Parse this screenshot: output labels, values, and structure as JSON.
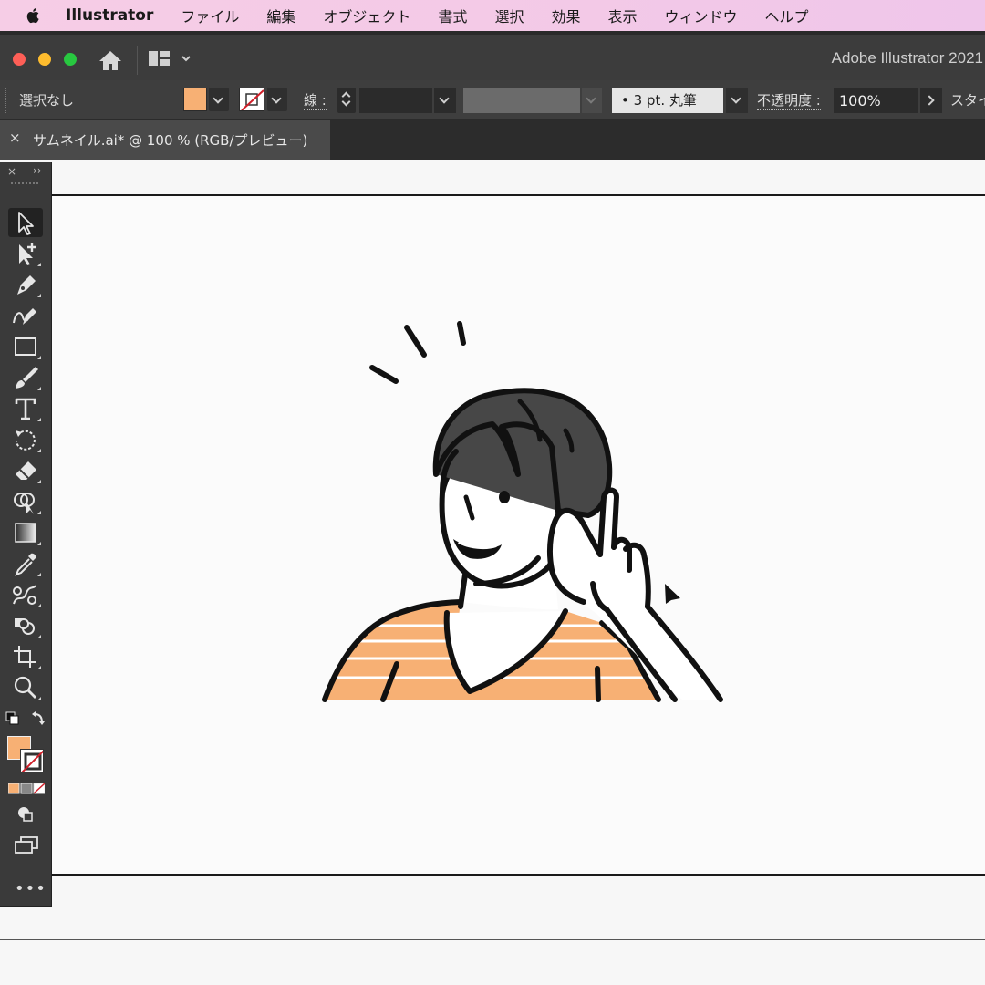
{
  "menubar": {
    "apple": "apple-logo",
    "app_name": "Illustrator",
    "items": [
      "ファイル",
      "編集",
      "オブジェクト",
      "書式",
      "選択",
      "効果",
      "表示",
      "ウィンドウ",
      "ヘルプ"
    ]
  },
  "window": {
    "title": "Adobe Illustrator 2021"
  },
  "control_bar": {
    "selection_status": "選択なし",
    "fill_color": "#f7b074",
    "stroke_label": "線 :",
    "brush_label": "•   3 pt. 丸筆",
    "opacity_label": "不透明度 :",
    "opacity_value": "100%",
    "style_label": "スタイ"
  },
  "tab": {
    "close_glyph": "×",
    "name": "サムネイル.ai* @ 100 % (RGB/プレビュー)"
  },
  "tools_panel": {
    "close_glyph": "×",
    "collapse_glyph": "››",
    "more_glyph": "•••",
    "tools": [
      "selection-tool",
      "direct-selection-tool",
      "pen-tool",
      "curvature-tool",
      "rectangle-tool",
      "paintbrush-tool",
      "type-tool",
      "rotate-tool",
      "eraser-tool",
      "shape-builder-tool",
      "gradient-tool",
      "eyedropper-tool",
      "blend-tool",
      "symbol-sprayer-tool",
      "artboard-tool",
      "zoom-tool"
    ],
    "fill_color": "#f7b074"
  },
  "colors": {
    "accent_orange": "#f7b074",
    "hair": "#474747",
    "ink": "#111111"
  }
}
